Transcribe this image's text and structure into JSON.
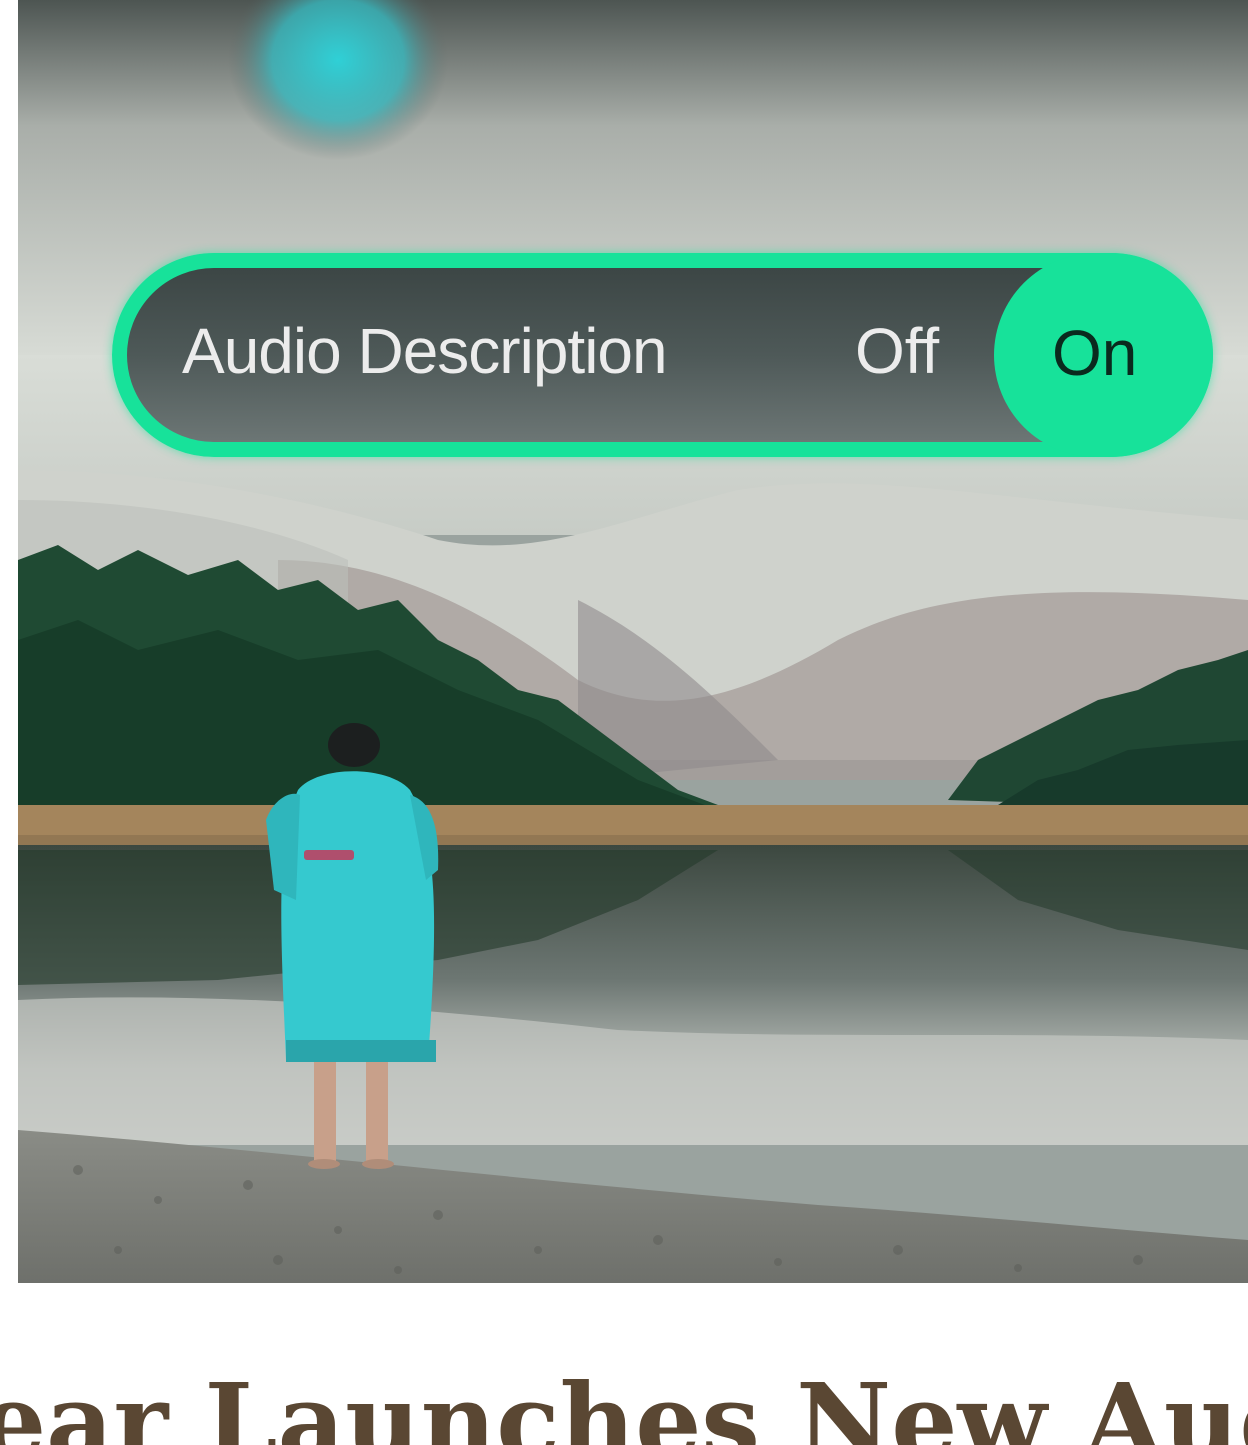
{
  "toggle": {
    "label": "Audio Description",
    "off_label": "Off",
    "on_label": "On",
    "state": "on",
    "accent_color": "#17e29a"
  },
  "article": {
    "headline_visible": "ear Launches New Audio Des"
  },
  "colors": {
    "headline": "#5a4733",
    "robe": "#35c9cf"
  }
}
